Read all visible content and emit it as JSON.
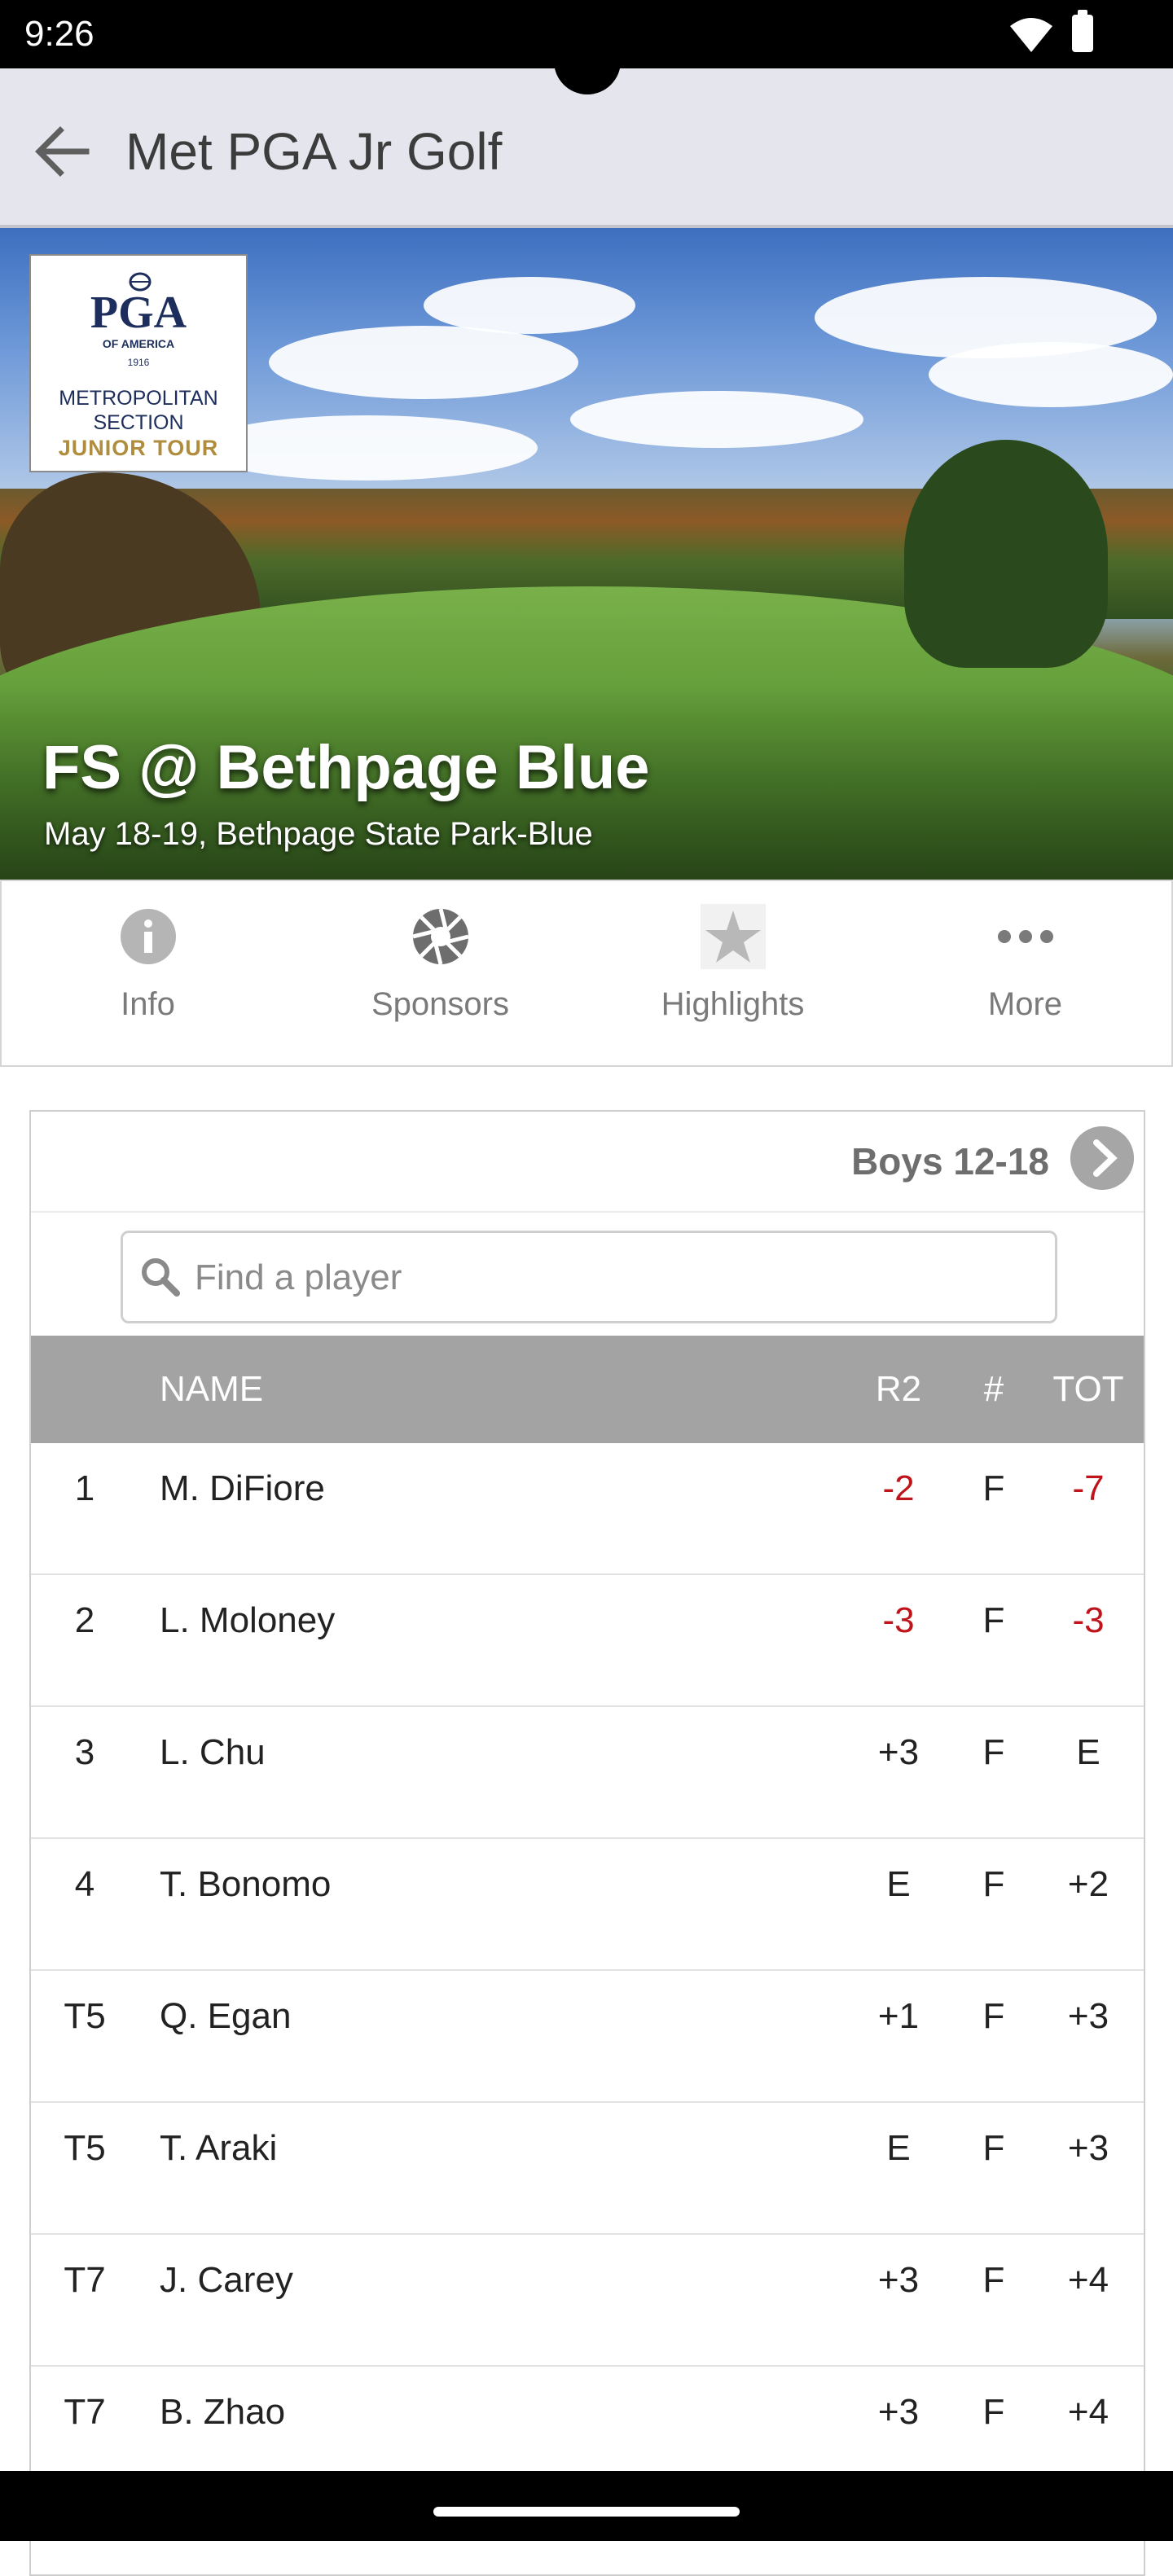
{
  "status_bar": {
    "time": "9:26"
  },
  "app_bar": {
    "title": "Met PGA Jr Golf"
  },
  "hero": {
    "logo": {
      "mark": "PGA",
      "sub": "OF AMERICA",
      "year": "1916",
      "line1": "METROPOLITAN",
      "line2": "SECTION",
      "tour": "JUNIOR TOUR"
    },
    "event_title": "FS @ Bethpage Blue",
    "event_subtitle": "May 18-19, Bethpage State Park-Blue"
  },
  "tabs": [
    {
      "label": "Info",
      "icon": "info-icon"
    },
    {
      "label": "Sponsors",
      "icon": "aperture-icon"
    },
    {
      "label": "Highlights",
      "icon": "star-icon"
    },
    {
      "label": "More",
      "icon": "more-dots-icon"
    }
  ],
  "leaderboard": {
    "division": "Boys 12-18",
    "search": {
      "placeholder": "Find a player",
      "value": ""
    },
    "columns": {
      "pos": "",
      "name": "NAME",
      "r2": "R2",
      "hole": "#",
      "tot": "TOT"
    },
    "rows": [
      {
        "pos": "1",
        "name": "M. DiFiore",
        "r2": "-2",
        "hole": "F",
        "tot": "-7"
      },
      {
        "pos": "2",
        "name": "L. Moloney",
        "r2": "-3",
        "hole": "F",
        "tot": "-3"
      },
      {
        "pos": "3",
        "name": "L. Chu",
        "r2": "+3",
        "hole": "F",
        "tot": "E"
      },
      {
        "pos": "4",
        "name": "T. Bonomo",
        "r2": "E",
        "hole": "F",
        "tot": "+2"
      },
      {
        "pos": "T5",
        "name": "Q. Egan",
        "r2": "+1",
        "hole": "F",
        "tot": "+3"
      },
      {
        "pos": "T5",
        "name": "T. Araki",
        "r2": "E",
        "hole": "F",
        "tot": "+3"
      },
      {
        "pos": "T7",
        "name": "J. Carey",
        "r2": "+3",
        "hole": "F",
        "tot": "+4"
      },
      {
        "pos": "T7",
        "name": "B. Zhao",
        "r2": "+3",
        "hole": "F",
        "tot": "+4"
      }
    ]
  },
  "colors": {
    "under_par": "#c0141b",
    "header_bg": "#a3a3a3",
    "app_bar_bg": "#e5e6ed",
    "logo_gold": "#b08d3c",
    "logo_navy": "#1d2e5c"
  }
}
